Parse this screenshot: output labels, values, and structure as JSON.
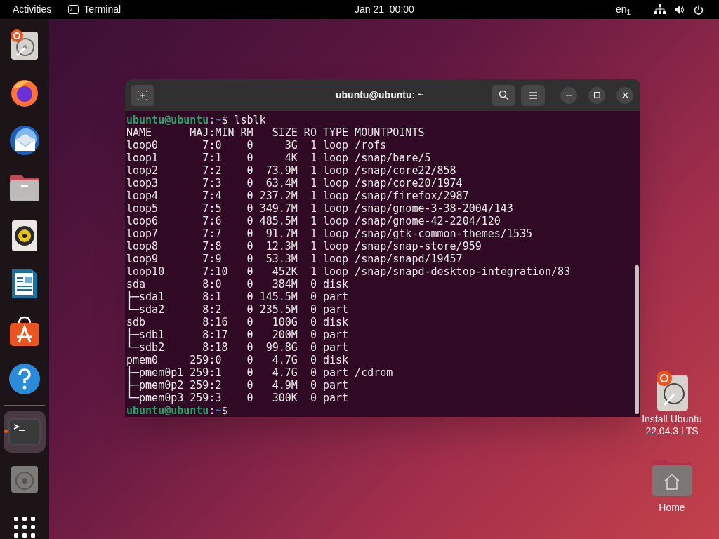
{
  "top_bar": {
    "activities": "Activities",
    "app_menu": "Terminal",
    "clock": "Jan 21  00:00",
    "keyboard_layout": "en$_{1}$"
  },
  "dock": {
    "items": [
      {
        "selected": false,
        "running": false
      },
      {
        "selected": false,
        "running": false
      },
      {
        "selected": false,
        "running": false
      },
      {
        "selected": false,
        "running": false
      },
      {
        "selected": false,
        "running": false
      },
      {
        "selected": false,
        "running": false
      },
      {
        "selected": false,
        "running": false
      },
      {
        "selected": false,
        "running": false
      },
      {
        "selected": true,
        "running": true
      },
      {
        "selected": false,
        "running": false
      },
      {
        "selected": false,
        "running": false
      }
    ]
  },
  "terminal": {
    "title": "ubuntu@ubuntu: ~",
    "lines": [
      {
        "kind": "prompt",
        "user": "ubuntu@ubuntu",
        "separator": ":",
        "path": "~",
        "symbol": "$",
        "command": "lsblk"
      },
      {
        "kind": "output",
        "text": "NAME      MAJ:MIN RM   SIZE RO TYPE MOUNTPOINTS"
      },
      {
        "kind": "output",
        "text": "loop0       7:0    0     3G  1 loop /rofs"
      },
      {
        "kind": "output",
        "text": "loop1       7:1    0     4K  1 loop /snap/bare/5"
      },
      {
        "kind": "output",
        "text": "loop2       7:2    0  73.9M  1 loop /snap/core22/858"
      },
      {
        "kind": "output",
        "text": "loop3       7:3    0  63.4M  1 loop /snap/core20/1974"
      },
      {
        "kind": "output",
        "text": "loop4       7:4    0 237.2M  1 loop /snap/firefox/2987"
      },
      {
        "kind": "output",
        "text": "loop5       7:5    0 349.7M  1 loop /snap/gnome-3-38-2004/143"
      },
      {
        "kind": "output",
        "text": "loop6       7:6    0 485.5M  1 loop /snap/gnome-42-2204/120"
      },
      {
        "kind": "output",
        "text": "loop7       7:7    0  91.7M  1 loop /snap/gtk-common-themes/1535"
      },
      {
        "kind": "output",
        "text": "loop8       7:8    0  12.3M  1 loop /snap/snap-store/959"
      },
      {
        "kind": "output",
        "text": "loop9       7:9    0  53.3M  1 loop /snap/snapd/19457"
      },
      {
        "kind": "output",
        "text": "loop10      7:10   0   452K  1 loop /snap/snapd-desktop-integration/83"
      },
      {
        "kind": "output",
        "text": "sda         8:0    0   384M  0 disk"
      },
      {
        "kind": "output",
        "text": "├─sda1      8:1    0 145.5M  0 part"
      },
      {
        "kind": "output",
        "text": "└─sda2      8:2    0 235.5M  0 part"
      },
      {
        "kind": "output",
        "text": "sdb         8:16   0   100G  0 disk"
      },
      {
        "kind": "output",
        "text": "├─sdb1      8:17   0   200M  0 part"
      },
      {
        "kind": "output",
        "text": "└─sdb2      8:18   0  99.8G  0 part"
      },
      {
        "kind": "output",
        "text": "pmem0     259:0    0   4.7G  0 disk"
      },
      {
        "kind": "output",
        "text": "├─pmem0p1 259:1    0   4.7G  0 part /cdrom"
      },
      {
        "kind": "output",
        "text": "├─pmem0p2 259:2    0   4.9M  0 part"
      },
      {
        "kind": "output",
        "text": "└─pmem0p3 259:3    0   300K  0 part"
      },
      {
        "kind": "prompt",
        "user": "ubuntu@ubuntu",
        "separator": ":",
        "path": "~",
        "symbol": "$"
      }
    ]
  },
  "desktop_icons": [
    {
      "label": "Install Ubuntu 22.04.3 LTS"
    },
    {
      "label": "Home"
    }
  ]
}
